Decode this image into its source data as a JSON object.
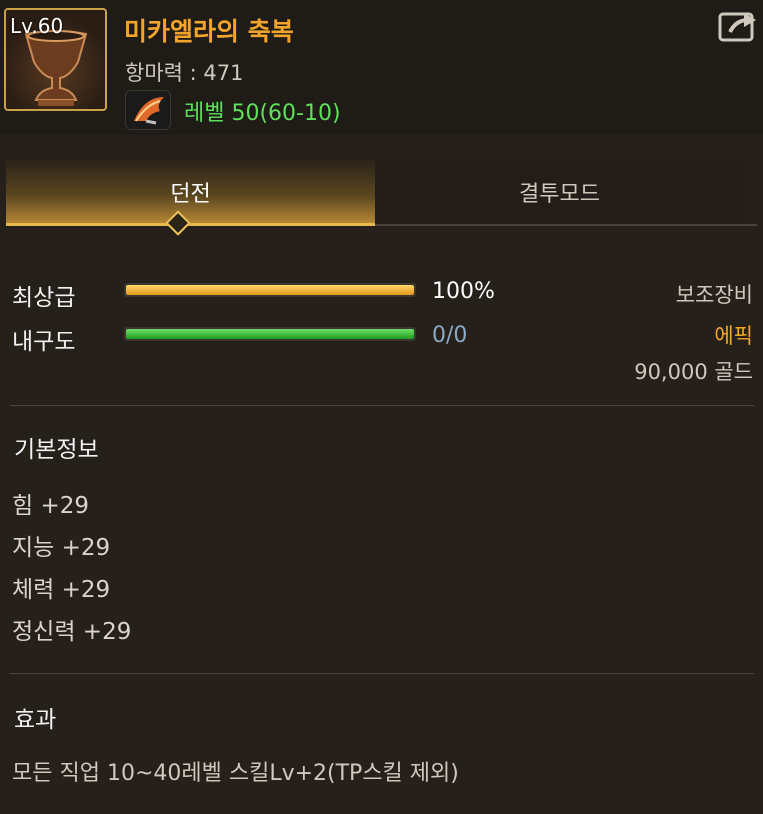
{
  "item": {
    "level_badge": "Lv.60",
    "name": "미카엘라의 축복",
    "magic_resist": "항마력 : 471",
    "level_requirement": "레벨 50(60-10)"
  },
  "tabs": [
    {
      "label": "던전",
      "active": true
    },
    {
      "label": "결투모드",
      "active": false
    }
  ],
  "stats": {
    "grade": {
      "label": "최상급",
      "value": "100%",
      "fill": 1.0
    },
    "durability": {
      "label": "내구도",
      "value": "0/0",
      "fill": 1.0
    }
  },
  "info": {
    "slot": "보조장비",
    "rarity": "에픽",
    "price": "90,000 골드"
  },
  "basic_info": {
    "title": "기본정보",
    "lines": [
      "힘 +29",
      "지능 +29",
      "체력 +29",
      "정신력 +29"
    ]
  },
  "effect": {
    "title": "효과",
    "text": "모든 직업 10~40레벨 스킬Lv+2(TP스킬 제외)"
  },
  "colors": {
    "title_orange": "#f3a52b",
    "level_green": "#5fe05a",
    "grade_bar": "#f0b52a",
    "durability_bar": "#2fbf2f",
    "durability_value": "#8aa8c8",
    "epic_orange": "#f3a52b"
  }
}
